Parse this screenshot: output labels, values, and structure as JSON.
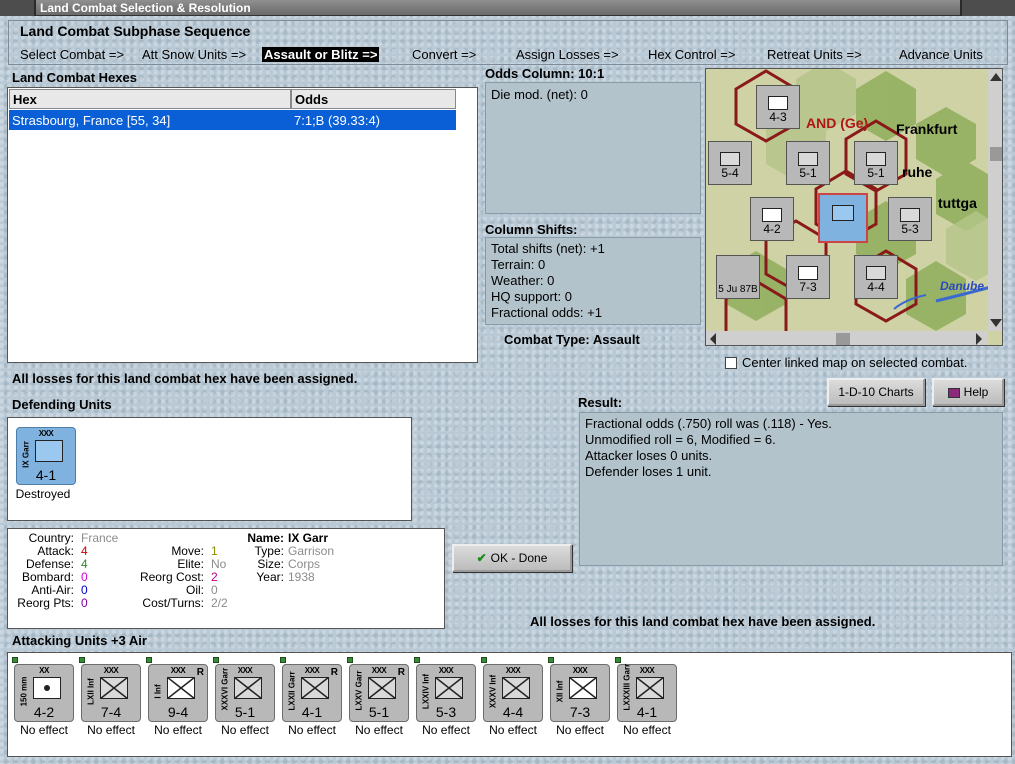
{
  "window": {
    "title": "Land Combat Selection & Resolution"
  },
  "sequence": {
    "title": "Land Combat Subphase Sequence",
    "steps": [
      "Select Combat =>",
      "Att Snow Units =>",
      "Assault or Blitz =>",
      "Convert =>",
      "Assign Losses =>",
      "Hex Control =>",
      "Retreat Units =>",
      "Advance Units"
    ]
  },
  "hexes": {
    "title": "Land Combat Hexes",
    "col_hex": "Hex",
    "col_odds": "Odds",
    "rows": [
      {
        "hex": "Strasbourg, France [55, 34]",
        "odds": "7:1;B (39.33:4)"
      }
    ]
  },
  "odds": {
    "title": "Odds Column: 10:1",
    "die_mod": "Die mod. (net): 0"
  },
  "shifts": {
    "title": "Column Shifts:",
    "lines": [
      "Total shifts (net): +1",
      "Terrain: 0",
      "Weather: 0",
      "HQ support: 0",
      "Fractional odds: +1"
    ]
  },
  "combat_type": "Combat Type:  Assault",
  "map": {
    "labels": {
      "frankfurt": "Frankfurt",
      "karlsruhe": "ruhe",
      "stuttgart": "tuttga",
      "danube": "Danube",
      "region": "AND (Ge)"
    },
    "center_linked": "Center linked map on selected combat."
  },
  "losses_msg": "All losses for this land combat hex have been assigned.",
  "losses_msg2": "All losses for this land combat hex have been assigned.",
  "buttons": {
    "charts": "1-D-10 Charts",
    "help": "Help",
    "ok": "OK - Done"
  },
  "result": {
    "title": "Result:",
    "lines": [
      "Fractional odds (.750) roll was (.118)  - Yes.",
      "Unmodified roll = 6, Modified = 6.",
      "Attacker loses 0 units.",
      "Defender loses 1 unit."
    ]
  },
  "defending": {
    "title": "Defending Units",
    "units": [
      {
        "size": "XXX",
        "name": "IX Garr",
        "strength": "4-1",
        "status": "Destroyed"
      }
    ]
  },
  "details": {
    "country_l": "Country:",
    "country": "France",
    "attack_l": "Attack:",
    "attack": "4",
    "defense_l": "Defense:",
    "defense": "4",
    "bombard_l": "Bombard:",
    "bombard": "0",
    "antiair_l": "Anti-Air:",
    "antiair": "0",
    "reorgpts_l": "Reorg Pts:",
    "reorgpts": "0",
    "move_l": "Move:",
    "move": "1",
    "elite_l": "Elite:",
    "elite": "No",
    "reorgcost_l": "Reorg Cost:",
    "reorgcost": "2",
    "oil_l": "Oil:",
    "oil": "0",
    "costturns_l": "Cost/Turns:",
    "costturns": "2/2",
    "name_l": "Name:",
    "name": "IX Garr",
    "type_l": "Type:",
    "type": "Garrison",
    "size_l": "Size:",
    "size": "Corps",
    "year_l": "Year:",
    "year": "1938"
  },
  "attacking": {
    "title": "Attacking Units +3 Air",
    "units": [
      {
        "size": "XX",
        "name": "150 mm",
        "strength": "4-2",
        "status": "No effect",
        "sym": "arty"
      },
      {
        "size": "XXX",
        "name": "LXII Inf",
        "strength": "7-4",
        "status": "No effect",
        "sym": "inf"
      },
      {
        "size": "XXX",
        "name": "I Inf",
        "strength": "9-4",
        "status": "No effect",
        "sym": "inf-w",
        "r": "R"
      },
      {
        "size": "XXX",
        "name": "XXXVI Garr",
        "strength": "5-1",
        "status": "No effect",
        "sym": "garr"
      },
      {
        "size": "XXX",
        "name": "LXXII Garr",
        "strength": "4-1",
        "status": "No effect",
        "sym": "garr",
        "r": "R"
      },
      {
        "size": "XXX",
        "name": "LXXV Garr",
        "strength": "5-1",
        "status": "No effect",
        "sym": "garr",
        "r": "R"
      },
      {
        "size": "XXX",
        "name": "LXXIV Inf",
        "strength": "5-3",
        "status": "No effect",
        "sym": "inf"
      },
      {
        "size": "XXX",
        "name": "XXXV Inf",
        "strength": "4-4",
        "status": "No effect",
        "sym": "inf"
      },
      {
        "size": "XXX",
        "name": "XII Inf",
        "strength": "7-3",
        "status": "No effect",
        "sym": "inf-w"
      },
      {
        "size": "XXX",
        "name": "LXXXIII Garr",
        "strength": "4-1",
        "status": "No effect",
        "sym": "garr"
      }
    ]
  },
  "colors": {
    "selection": "#0a5fd6",
    "attack": "#cc0000",
    "defense": "#2a8a2a",
    "bombard": "#d000d0",
    "antiair": "#0000cc",
    "reorgpts": "#8000a0",
    "move": "#8a8a00",
    "reorgcost": "#c00080"
  }
}
